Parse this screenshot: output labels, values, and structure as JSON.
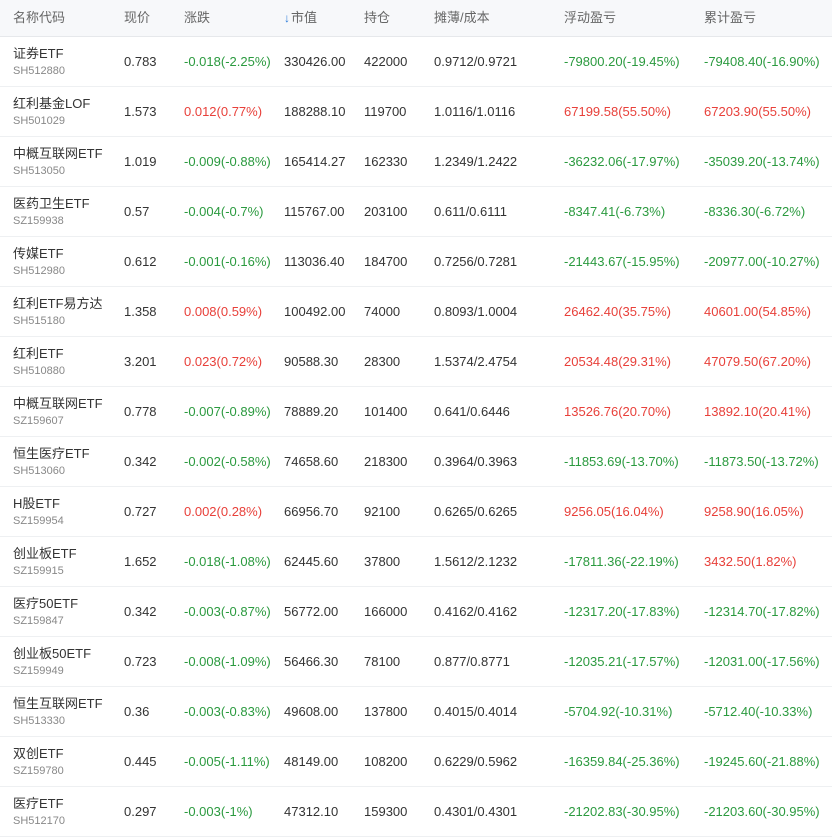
{
  "header": {
    "name": "名称代码",
    "price": "现价",
    "change": "涨跌",
    "sort_arrow": "↓",
    "market_value": "市值",
    "position": "持仓",
    "cost": "摊薄/成本",
    "float_pnl": "浮动盈亏",
    "total_pnl": "累计盈亏"
  },
  "colors": {
    "up": "#e8403a",
    "down": "#2b9a3f",
    "accent": "#2b7bd9"
  },
  "rows": [
    {
      "name": "证券ETF",
      "code": "SH512880",
      "price": "0.783",
      "change": "-0.018(-2.25%)",
      "change_dir": "down",
      "market_value": "330426.00",
      "position": "422000",
      "cost": "0.9712/0.9721",
      "float_pnl": "-79800.20(-19.45%)",
      "float_dir": "down",
      "total_pnl": "-79408.40(-16.90%)",
      "total_dir": "down"
    },
    {
      "name": "红利基金LOF",
      "code": "SH501029",
      "price": "1.573",
      "change": "0.012(0.77%)",
      "change_dir": "up",
      "market_value": "188288.10",
      "position": "119700",
      "cost": "1.0116/1.0116",
      "float_pnl": "67199.58(55.50%)",
      "float_dir": "up",
      "total_pnl": "67203.90(55.50%)",
      "total_dir": "up"
    },
    {
      "name": "中概互联网ETF",
      "code": "SH513050",
      "price": "1.019",
      "change": "-0.009(-0.88%)",
      "change_dir": "down",
      "market_value": "165414.27",
      "position": "162330",
      "cost": "1.2349/1.2422",
      "float_pnl": "-36232.06(-17.97%)",
      "float_dir": "down",
      "total_pnl": "-35039.20(-13.74%)",
      "total_dir": "down"
    },
    {
      "name": "医药卫生ETF",
      "code": "SZ159938",
      "price": "0.57",
      "change": "-0.004(-0.7%)",
      "change_dir": "down",
      "market_value": "115767.00",
      "position": "203100",
      "cost": "0.611/0.6111",
      "float_pnl": "-8347.41(-6.73%)",
      "float_dir": "down",
      "total_pnl": "-8336.30(-6.72%)",
      "total_dir": "down"
    },
    {
      "name": "传媒ETF",
      "code": "SH512980",
      "price": "0.612",
      "change": "-0.001(-0.16%)",
      "change_dir": "down",
      "market_value": "113036.40",
      "position": "184700",
      "cost": "0.7256/0.7281",
      "float_pnl": "-21443.67(-15.95%)",
      "float_dir": "down",
      "total_pnl": "-20977.00(-10.27%)",
      "total_dir": "down"
    },
    {
      "name": "红利ETF易方达",
      "code": "SH515180",
      "price": "1.358",
      "change": "0.008(0.59%)",
      "change_dir": "up",
      "market_value": "100492.00",
      "position": "74000",
      "cost": "0.8093/1.0004",
      "float_pnl": "26462.40(35.75%)",
      "float_dir": "up",
      "total_pnl": "40601.00(54.85%)",
      "total_dir": "up"
    },
    {
      "name": "红利ETF",
      "code": "SH510880",
      "price": "3.201",
      "change": "0.023(0.72%)",
      "change_dir": "up",
      "market_value": "90588.30",
      "position": "28300",
      "cost": "1.5374/2.4754",
      "float_pnl": "20534.48(29.31%)",
      "float_dir": "up",
      "total_pnl": "47079.50(67.20%)",
      "total_dir": "up"
    },
    {
      "name": "中概互联网ETF",
      "code": "SZ159607",
      "price": "0.778",
      "change": "-0.007(-0.89%)",
      "change_dir": "down",
      "market_value": "78889.20",
      "position": "101400",
      "cost": "0.641/0.6446",
      "float_pnl": "13526.76(20.70%)",
      "float_dir": "up",
      "total_pnl": "13892.10(20.41%)",
      "total_dir": "up"
    },
    {
      "name": "恒生医疗ETF",
      "code": "SH513060",
      "price": "0.342",
      "change": "-0.002(-0.58%)",
      "change_dir": "down",
      "market_value": "74658.60",
      "position": "218300",
      "cost": "0.3964/0.3963",
      "float_pnl": "-11853.69(-13.70%)",
      "float_dir": "down",
      "total_pnl": "-11873.50(-13.72%)",
      "total_dir": "down"
    },
    {
      "name": "H股ETF",
      "code": "SZ159954",
      "price": "0.727",
      "change": "0.002(0.28%)",
      "change_dir": "up",
      "market_value": "66956.70",
      "position": "92100",
      "cost": "0.6265/0.6265",
      "float_pnl": "9256.05(16.04%)",
      "float_dir": "up",
      "total_pnl": "9258.90(16.05%)",
      "total_dir": "up"
    },
    {
      "name": "创业板ETF",
      "code": "SZ159915",
      "price": "1.652",
      "change": "-0.018(-1.08%)",
      "change_dir": "down",
      "market_value": "62445.60",
      "position": "37800",
      "cost": "1.5612/2.1232",
      "float_pnl": "-17811.36(-22.19%)",
      "float_dir": "down",
      "total_pnl": "3432.50(1.82%)",
      "total_dir": "up"
    },
    {
      "name": "医疗50ETF",
      "code": "SZ159847",
      "price": "0.342",
      "change": "-0.003(-0.87%)",
      "change_dir": "down",
      "market_value": "56772.00",
      "position": "166000",
      "cost": "0.4162/0.4162",
      "float_pnl": "-12317.20(-17.83%)",
      "float_dir": "down",
      "total_pnl": "-12314.70(-17.82%)",
      "total_dir": "down"
    },
    {
      "name": "创业板50ETF",
      "code": "SZ159949",
      "price": "0.723",
      "change": "-0.008(-1.09%)",
      "change_dir": "down",
      "market_value": "56466.30",
      "position": "78100",
      "cost": "0.877/0.8771",
      "float_pnl": "-12035.21(-17.57%)",
      "float_dir": "down",
      "total_pnl": "-12031.00(-17.56%)",
      "total_dir": "down"
    },
    {
      "name": "恒生互联网ETF",
      "code": "SH513330",
      "price": "0.36",
      "change": "-0.003(-0.83%)",
      "change_dir": "down",
      "market_value": "49608.00",
      "position": "137800",
      "cost": "0.4015/0.4014",
      "float_pnl": "-5704.92(-10.31%)",
      "float_dir": "down",
      "total_pnl": "-5712.40(-10.33%)",
      "total_dir": "down"
    },
    {
      "name": "双创ETF",
      "code": "SZ159780",
      "price": "0.445",
      "change": "-0.005(-1.11%)",
      "change_dir": "down",
      "market_value": "48149.00",
      "position": "108200",
      "cost": "0.6229/0.5962",
      "float_pnl": "-16359.84(-25.36%)",
      "float_dir": "down",
      "total_pnl": "-19245.60(-21.88%)",
      "total_dir": "down"
    },
    {
      "name": "医疗ETF",
      "code": "SH512170",
      "price": "0.297",
      "change": "-0.003(-1%)",
      "change_dir": "down",
      "market_value": "47312.10",
      "position": "159300",
      "cost": "0.4301/0.4301",
      "float_pnl": "-21202.83(-30.95%)",
      "float_dir": "down",
      "total_pnl": "-21203.60(-30.95%)",
      "total_dir": "down"
    }
  ]
}
